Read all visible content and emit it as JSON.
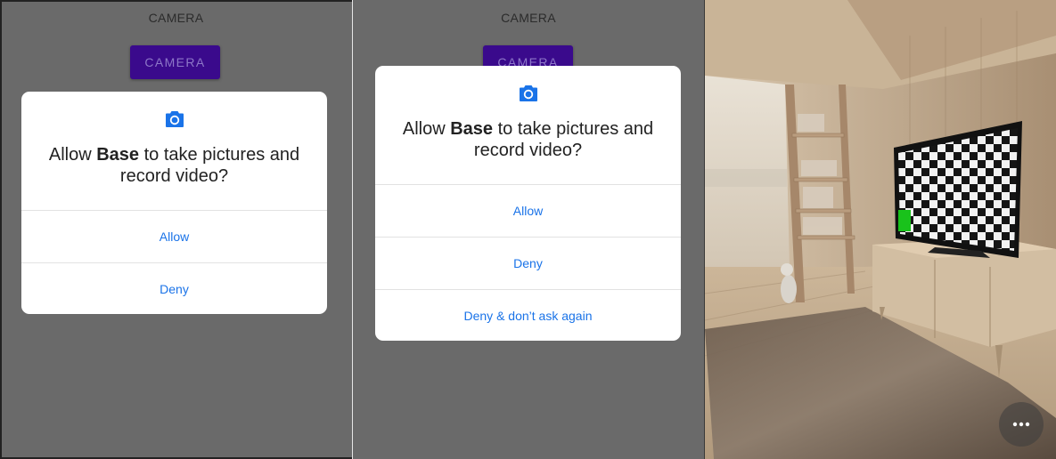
{
  "screens": [
    {
      "app_title": "CAMERA",
      "camera_button": "CAMERA",
      "dialog": {
        "icon": "camera-icon",
        "message_pre": "Allow ",
        "message_app": "Base",
        "message_post": " to take pictures and record video?",
        "buttons": [
          "Allow",
          "Deny"
        ]
      }
    },
    {
      "app_title": "CAMERA",
      "camera_button": "CAMERA",
      "dialog": {
        "icon": "camera-icon",
        "message_pre": "Allow ",
        "message_app": "Base",
        "message_post": " to take pictures and record video?",
        "buttons": [
          "Allow",
          "Deny",
          "Deny & don’t ask again"
        ]
      }
    }
  ],
  "camera_view": {
    "more_button_icon": "more-horizontal-icon"
  },
  "colors": {
    "scrim": "#6a6a6a",
    "button_primary": "#3a0a8c",
    "dialog_action": "#1a73e8",
    "marker": "#19c21b"
  }
}
